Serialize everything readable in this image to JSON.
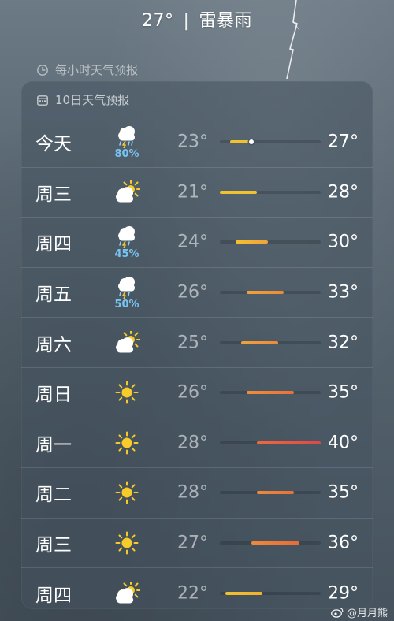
{
  "header": {
    "temperature": "27°",
    "separator": "|",
    "condition": "雷暴雨"
  },
  "hourly": {
    "label": "每小时天气预报",
    "icon": "clock-icon"
  },
  "forecast": {
    "title": "10日天气预报",
    "icon": "calendar-icon",
    "range": {
      "min": 21,
      "max": 40
    },
    "current_temp": 27,
    "days": [
      {
        "day": "今天",
        "icon": "thunderstorm-rain-icon",
        "precip": "80%",
        "low": "23°",
        "high": "27°",
        "low_n": 23,
        "high_n": 27,
        "color_from": "#f2c12e",
        "color_to": "#f2c12e",
        "now": true
      },
      {
        "day": "周三",
        "icon": "partly-cloudy-icon",
        "precip": "",
        "low": "21°",
        "high": "28°",
        "low_n": 21,
        "high_n": 28,
        "color_from": "#f2c12e",
        "color_to": "#f2c12e",
        "now": false
      },
      {
        "day": "周四",
        "icon": "thunderstorm-icon",
        "precip": "45%",
        "low": "24°",
        "high": "30°",
        "low_n": 24,
        "high_n": 30,
        "color_from": "#f2c12e",
        "color_to": "#f0a23c",
        "now": false
      },
      {
        "day": "周五",
        "icon": "thunderstorm-icon",
        "precip": "50%",
        "low": "26°",
        "high": "33°",
        "low_n": 26,
        "high_n": 33,
        "color_from": "#f0a23c",
        "color_to": "#ec8a3a",
        "now": false
      },
      {
        "day": "周六",
        "icon": "partly-cloudy-icon",
        "precip": "",
        "low": "25°",
        "high": "32°",
        "low_n": 25,
        "high_n": 32,
        "color_from": "#f0a23c",
        "color_to": "#ec8a3a",
        "now": false
      },
      {
        "day": "周日",
        "icon": "sun-icon",
        "precip": "",
        "low": "26°",
        "high": "35°",
        "low_n": 26,
        "high_n": 35,
        "color_from": "#ee8f3a",
        "color_to": "#e9703a",
        "now": false
      },
      {
        "day": "周一",
        "icon": "sun-icon",
        "precip": "",
        "low": "28°",
        "high": "40°",
        "low_n": 28,
        "high_n": 40,
        "color_from": "#ec6a3e",
        "color_to": "#e04848",
        "now": false
      },
      {
        "day": "周二",
        "icon": "sun-icon",
        "precip": "",
        "low": "28°",
        "high": "35°",
        "low_n": 28,
        "high_n": 35,
        "color_from": "#ee8a3a",
        "color_to": "#e9703a",
        "now": false
      },
      {
        "day": "周三",
        "icon": "sun-icon",
        "precip": "",
        "low": "27°",
        "high": "36°",
        "low_n": 27,
        "high_n": 36,
        "color_from": "#ee8a3a",
        "color_to": "#e86a3a",
        "now": false
      },
      {
        "day": "周四",
        "icon": "partly-cloudy-icon",
        "precip": "",
        "low": "22°",
        "high": "29°",
        "low_n": 22,
        "high_n": 29,
        "color_from": "#f2c12e",
        "color_to": "#f2b02e",
        "now": false
      }
    ]
  },
  "watermark": {
    "text": "@月月熊",
    "icon": "weibo-icon"
  }
}
